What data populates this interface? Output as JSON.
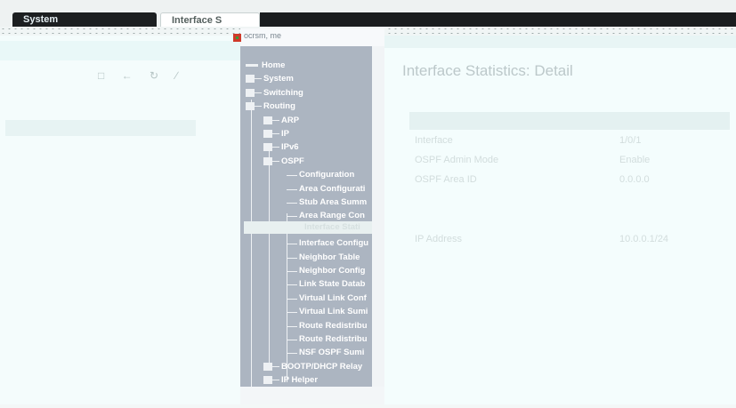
{
  "tabs": [
    {
      "label": "System",
      "active": true
    },
    {
      "label": "Interface S",
      "active": false
    }
  ],
  "tree": {
    "header": "ocrsm, me",
    "items": [
      "Home",
      "System",
      "Switching",
      "Routing",
      "ARP",
      "IP",
      "IPv6",
      "OSPF",
      "Configuration",
      "Area Configurati",
      "Stub Area Summ",
      "Area Range Con",
      "Interface Stati",
      "Interface Configu",
      "Neighbor Table",
      "Neighbor Config",
      "Link State Datab",
      "Virtual Link Conf",
      "Virtual Link Sumi",
      "Route Redistribu",
      "Route Redistribu",
      "NSF OSPF Sumi",
      "BOOTP/DHCP Relay",
      "IP Helper"
    ],
    "selected_index": 12
  },
  "page": {
    "title": "Interface Statistics: Detail"
  },
  "stats_rows": [
    {
      "label": "Interface",
      "value": "1/0/1"
    },
    {
      "label": "OSPF Admin Mode",
      "value": "Enable"
    },
    {
      "label": "OSPF Area ID",
      "value": "0.0.0.0"
    },
    {
      "label": "",
      "value": ""
    },
    {
      "label": "",
      "value": ""
    },
    {
      "label": "IP Address",
      "value": "10.0.0.1/24"
    },
    {
      "label": "",
      "value": ""
    },
    {
      "label": "",
      "value": ""
    },
    {
      "label": "",
      "value": ""
    },
    {
      "label": "",
      "value": ""
    },
    {
      "label": "",
      "value": ""
    },
    {
      "label": "",
      "value": ""
    },
    {
      "label": "",
      "value": ""
    },
    {
      "label": "",
      "value": ""
    }
  ],
  "colors": {
    "accent_dark": "#1c1f21",
    "nav_bg": "#acb5c1",
    "panel_bg": "#f4fdfd"
  }
}
